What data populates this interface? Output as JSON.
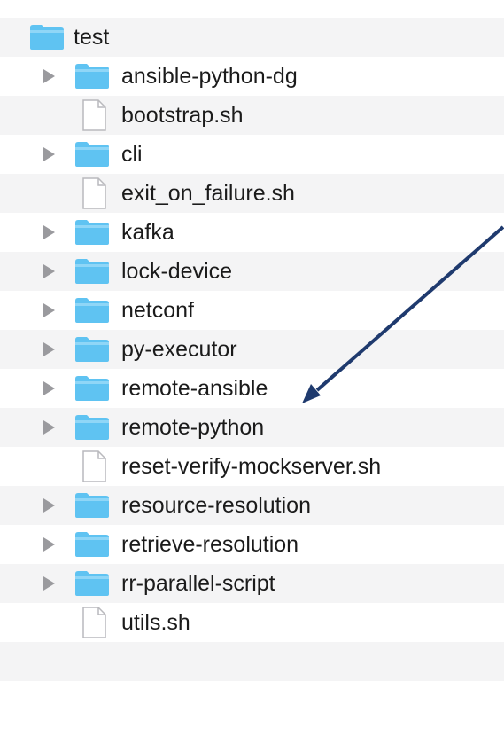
{
  "root": {
    "name": "test",
    "icon": "folder-icon",
    "expanded": true
  },
  "items": [
    {
      "name": "ansible-python-dg",
      "kind": "folder",
      "icon": "folder-icon"
    },
    {
      "name": "bootstrap.sh",
      "kind": "file",
      "icon": "document-icon"
    },
    {
      "name": "cli",
      "kind": "folder",
      "icon": "folder-icon"
    },
    {
      "name": "exit_on_failure.sh",
      "kind": "file",
      "icon": "document-icon"
    },
    {
      "name": "kafka",
      "kind": "folder",
      "icon": "folder-icon"
    },
    {
      "name": "lock-device",
      "kind": "folder",
      "icon": "folder-icon"
    },
    {
      "name": "netconf",
      "kind": "folder",
      "icon": "folder-icon"
    },
    {
      "name": "py-executor",
      "kind": "folder",
      "icon": "folder-icon"
    },
    {
      "name": "remote-ansible",
      "kind": "folder",
      "icon": "folder-icon"
    },
    {
      "name": "remote-python",
      "kind": "folder",
      "icon": "folder-icon"
    },
    {
      "name": "reset-verify-mockserver.sh",
      "kind": "file",
      "icon": "document-icon"
    },
    {
      "name": "resource-resolution",
      "kind": "folder",
      "icon": "folder-icon"
    },
    {
      "name": "retrieve-resolution",
      "kind": "folder",
      "icon": "folder-icon"
    },
    {
      "name": "rr-parallel-script",
      "kind": "folder",
      "icon": "folder-icon"
    },
    {
      "name": "utils.sh",
      "kind": "file",
      "icon": "document-icon"
    }
  ],
  "annotation": {
    "icon": "annotation-arrow-icon",
    "color": "#1f3a6e"
  },
  "colors": {
    "folder": "#5fc3f2",
    "folder_tab": "#8fd6f7",
    "stripe": "#f4f4f5",
    "disclosure": "#9a9a9e",
    "text": "#1b1b1b"
  }
}
